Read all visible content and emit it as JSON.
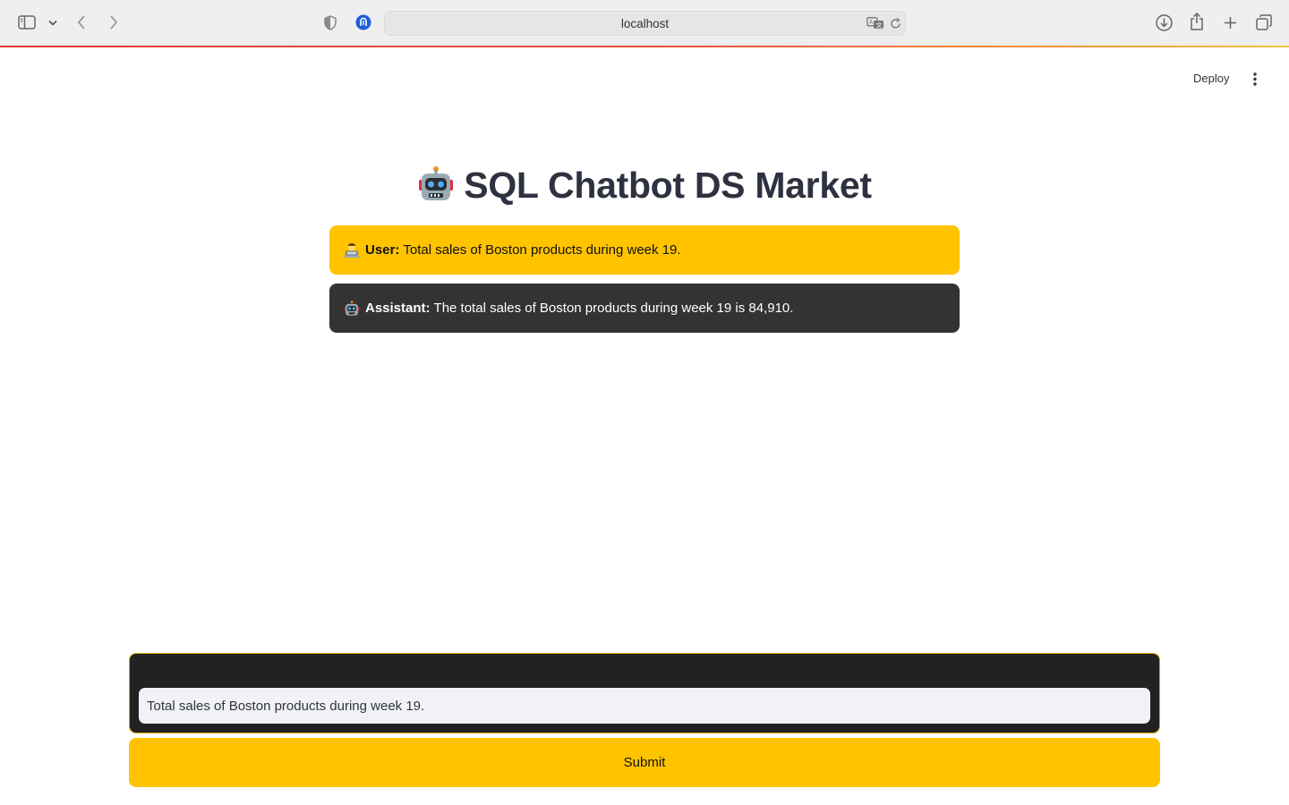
{
  "browser": {
    "url": "localhost",
    "icons": [
      "sidebar-icon",
      "chevron-down-icon",
      "back-icon",
      "forward-icon",
      "shield-icon",
      "password-icon",
      "translate-icon",
      "reload-icon",
      "download-icon",
      "share-icon",
      "new-tab-icon",
      "tabs-overview-icon"
    ]
  },
  "header": {
    "deploy_label": "Deploy",
    "menu_icon": "more-vertical-icon"
  },
  "page": {
    "title": "SQL Chatbot DS Market",
    "title_icon": "robot-icon"
  },
  "chat": {
    "messages": [
      {
        "role_label": "User:",
        "text": "Total sales of Boston products during week 19.",
        "icon": "user-technologist-icon",
        "bg": "#ffc300"
      },
      {
        "role_label": "Assistant:",
        "text": "The total sales of Boston products during week 19 is 84,910.",
        "icon": "robot-icon",
        "bg": "#333333"
      }
    ]
  },
  "form": {
    "input_value": "Total sales of Boston products during week 19.",
    "submit_label": "Submit"
  },
  "colors": {
    "accent": "#ffc300",
    "assistant_bg": "#333333",
    "form_bg": "#222222",
    "title": "#2e3140"
  }
}
